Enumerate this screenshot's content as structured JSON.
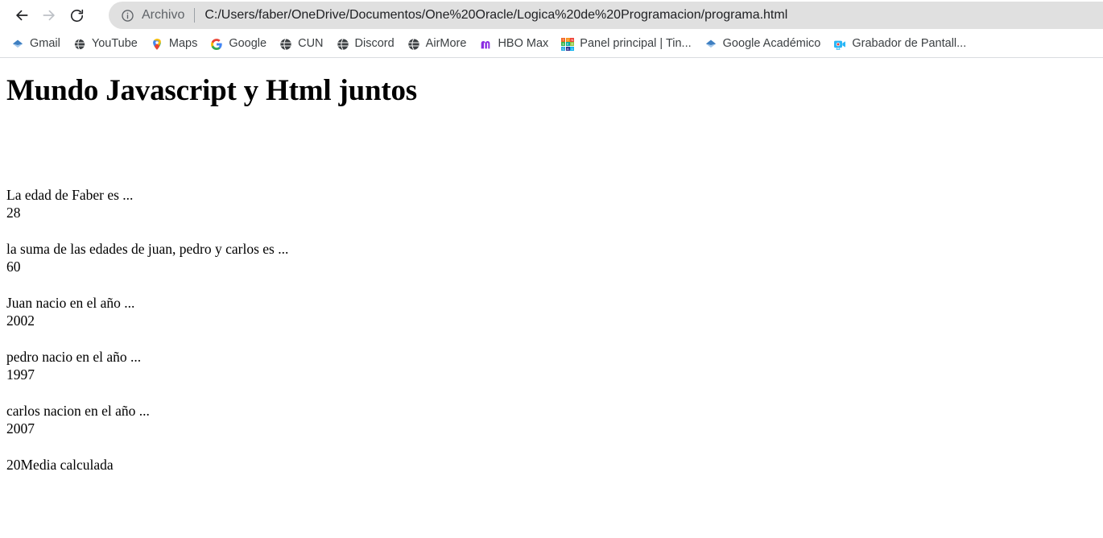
{
  "browser": {
    "toolbar": {
      "back_icon": "arrow-left-icon",
      "forward_icon": "arrow-right-icon",
      "reload_icon": "reload-icon",
      "back_enabled": true,
      "forward_enabled": false
    },
    "omnibox": {
      "info_icon": "info-circle-icon",
      "scheme_label": "Archivo",
      "separator": "|",
      "url": "C:/Users/faber/OneDrive/Documentos/One%20Oracle/Logica%20de%20Programacion/programa.html",
      "background_color": "#e0e0e0",
      "scheme_color": "#5f6368",
      "url_color": "#202124"
    },
    "bookmarks": [
      {
        "label": "Gmail",
        "icon": "blue-diamond-icon",
        "icon_color": "#4a90e2"
      },
      {
        "label": "YouTube",
        "icon": "globe-icon",
        "icon_color": "#202124"
      },
      {
        "label": "Maps",
        "icon": "map-pin-icon",
        "icon_color": "#34a853"
      },
      {
        "label": "Google",
        "icon": "google-g-icon",
        "icon_color": "#ea4335"
      },
      {
        "label": "CUN",
        "icon": "globe-icon",
        "icon_color": "#202124"
      },
      {
        "label": "Discord",
        "icon": "globe-icon",
        "icon_color": "#202124"
      },
      {
        "label": "AirMore",
        "icon": "globe-icon",
        "icon_color": "#202124"
      },
      {
        "label": "HBO Max",
        "icon": "hbomax-m-icon",
        "icon_color": "#8a2be2"
      },
      {
        "label": "Panel principal | Tin...",
        "icon": "tinkercad-grid-icon",
        "icon_color": "#f26522"
      },
      {
        "label": "Google Académico",
        "icon": "blue-diamond-icon",
        "icon_color": "#4a90e2"
      },
      {
        "label": "Grabador de Pantall...",
        "icon": "video-camera-record-icon",
        "icon_color": "#2196f3"
      }
    ],
    "tinkercad_letters": [
      "T",
      "I",
      "N",
      "K",
      "E",
      "R",
      "C",
      "A",
      "D"
    ],
    "tinkercad_colors": [
      "#f26522",
      "#f7941e",
      "#ef4136",
      "#39b54a",
      "#00a99d",
      "#8dc63f",
      "#27aae1",
      "#2e3192",
      "#00aeef"
    ]
  },
  "page": {
    "title": "Mundo Javascript y Html juntos",
    "lines": [
      "La edad de Faber es ...",
      "28",
      "",
      "la suma de las edades de juan, pedro y carlos es ...",
      "60",
      "",
      "Juan nacio en el año ...",
      "2002",
      "",
      "pedro nacio en el año ...",
      "1997",
      "",
      "carlos nacion en el año ...",
      "2007",
      "",
      "20Media calculada"
    ]
  }
}
